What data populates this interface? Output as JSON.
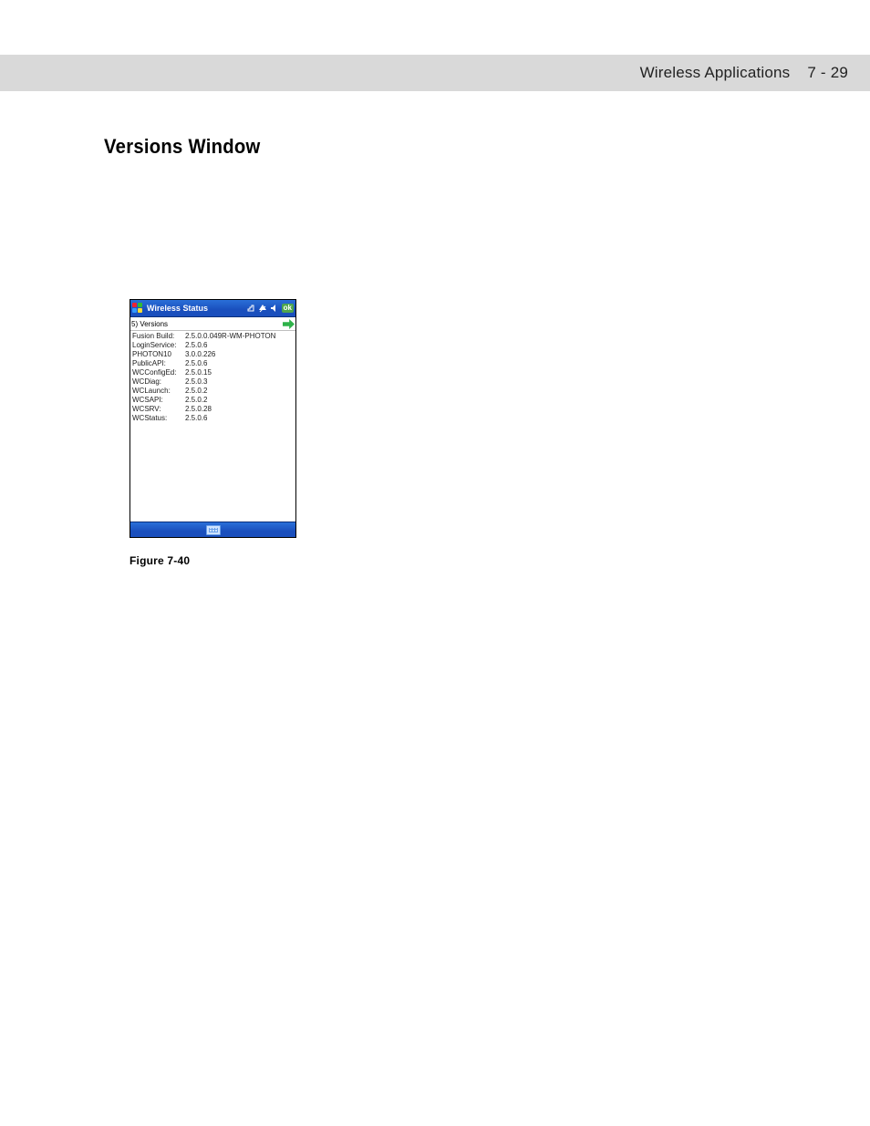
{
  "header": {
    "chapter": "Wireless Applications",
    "page": "7 - 29"
  },
  "section_title": "Versions Window",
  "device": {
    "titlebar_label": "Wireless Status",
    "ok_label": "ok",
    "subbar_label": "5) Versions",
    "rows": [
      {
        "label": "Fusion Build:",
        "value": "2.5.0.0.049R-WM-PHOTON"
      },
      {
        "label": "LoginService:",
        "value": "2.5.0.6"
      },
      {
        "label": "PHOTON10",
        "value": "3.0.0.226"
      },
      {
        "label": "PublicAPI:",
        "value": "2.5.0.6"
      },
      {
        "label": "WCConfigEd:",
        "value": "2.5.0.15"
      },
      {
        "label": "WCDiag:",
        "value": "2.5.0.3"
      },
      {
        "label": "WCLaunch:",
        "value": "2.5.0.2"
      },
      {
        "label": "WCSAPI:",
        "value": "2.5.0.2"
      },
      {
        "label": "WCSRV:",
        "value": "2.5.0.28"
      },
      {
        "label": "WCStatus:",
        "value": "2.5.0.6"
      }
    ]
  },
  "figure_caption": "Figure 7-40"
}
